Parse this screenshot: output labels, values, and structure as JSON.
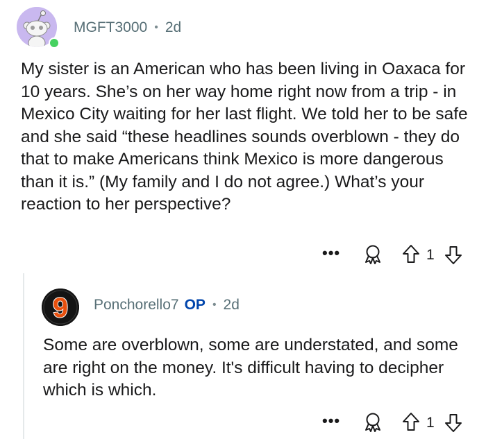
{
  "comment": {
    "username": "MGFT3000",
    "separator": "•",
    "age": "2d",
    "body": "My sister is an American who has been living in Oaxaca for 10 years. She’s on her way home right now from a trip - in Mexico City waiting for her last flight. We told her to be safe and she said “these headlines sounds overblown - they do that to make Americans think Mexico is more dangerous than it is.” (My family and I do not agree.) What’s your reaction to her perspective?",
    "more_label": "•••",
    "vote_count": "1",
    "icons": [
      "avatar-snoo-icon",
      "award-icon",
      "upvote-arrow-icon",
      "downvote-arrow-icon"
    ],
    "avatar_color": "#c9b8ef",
    "online_color": "#46d160"
  },
  "reply": {
    "username": "Ponchorello7",
    "op_badge": "OP",
    "separator": "•",
    "age": "2d",
    "body": "Some are overblown, some are understated, and some are right on the money. It's difficult having to decipher which is which.",
    "avatar_text": "9",
    "more_label": "•••",
    "vote_count": "1",
    "op_color": "#0045ac",
    "avatar_accent": "#e8500e"
  }
}
